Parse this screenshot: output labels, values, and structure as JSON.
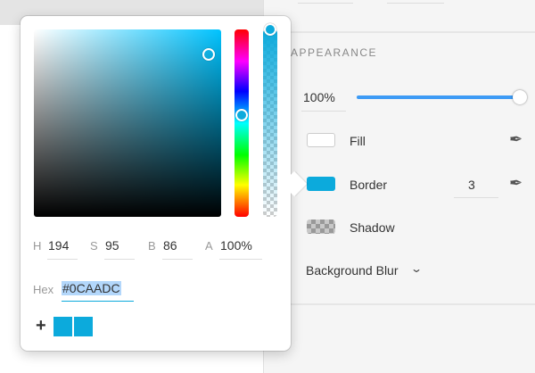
{
  "appearance": {
    "title": "APPEARANCE",
    "opacity": "100%",
    "opacity_fraction": 1.0,
    "fill": {
      "label": "Fill",
      "color": "#ffffff"
    },
    "border": {
      "label": "Border",
      "color": "#0caadc",
      "width": "3"
    },
    "shadow": {
      "label": "Shadow"
    },
    "background_blur": {
      "label": "Background Blur"
    }
  },
  "picker": {
    "h_label": "H",
    "h": "194",
    "s_label": "S",
    "s": "95",
    "b_label": "B",
    "b": "86",
    "a_label": "A",
    "a": "100%",
    "hex_label": "Hex",
    "hex": "#0CAADC",
    "add": "+",
    "swatches": [
      "#0caadc",
      "#0caadc"
    ]
  }
}
